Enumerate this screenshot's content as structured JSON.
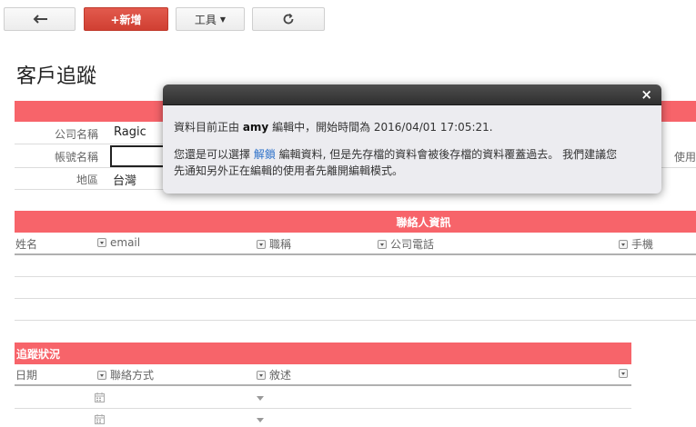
{
  "toolbar": {
    "back_icon": "arrow-left-icon",
    "new_label": "+新增",
    "tools_label": "工具",
    "refresh_icon": "refresh-icon"
  },
  "page": {
    "title": "客戶追蹤"
  },
  "company": {
    "fields": [
      {
        "label": "公司名稱",
        "value": "Ragic"
      },
      {
        "label": "帳號名稱",
        "value": ""
      },
      {
        "label": "地區",
        "value": "台灣"
      }
    ],
    "right_label_partial": "使用"
  },
  "contacts": {
    "title": "聯絡人資訊",
    "columns": [
      "姓名",
      "email",
      "職稱",
      "公司電話",
      "手機"
    ]
  },
  "tracking": {
    "title": "追蹤狀況",
    "columns": [
      "日期",
      "聯絡方式",
      "敘述"
    ]
  },
  "modal": {
    "line1_prefix": "資料目前正由 ",
    "line1_user": "amy",
    "line1_suffix": " 編輯中，開始時間為 2016/04/01 17:05:21.",
    "line2_prefix": "您還是可以選擇 ",
    "line2_link": "解鎖",
    "line2_suffix": " 編輯資料, 但是先存檔的資料會被後存檔的資料覆蓋過去。 我們建議您",
    "line3": "先通知另外正在編輯的使用者先離開編輯模式。",
    "close_label": "×"
  },
  "colors": {
    "accent_red": "#f7646a",
    "primary_button": "#d03f32",
    "link": "#2a6fc9"
  }
}
